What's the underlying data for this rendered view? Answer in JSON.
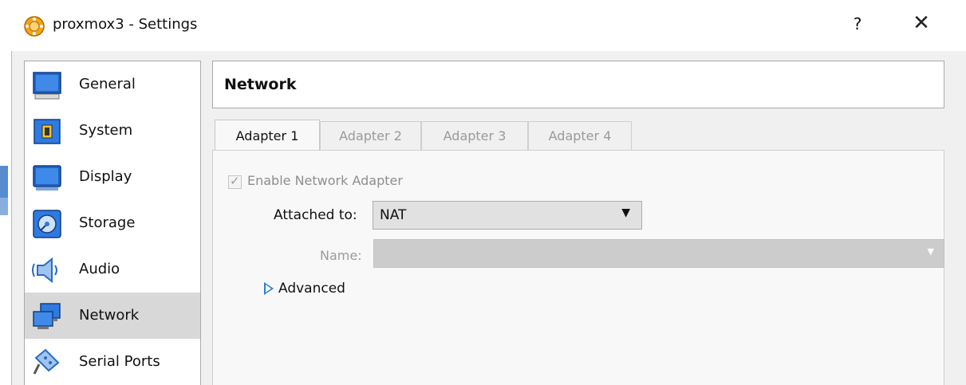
{
  "window": {
    "title": "proxmox3 - Settings",
    "help_label": "?",
    "close_label": "✕"
  },
  "sidebar": {
    "items": [
      {
        "label": "General",
        "icon": "general-icon",
        "selected": false
      },
      {
        "label": "System",
        "icon": "system-icon",
        "selected": false
      },
      {
        "label": "Display",
        "icon": "display-icon",
        "selected": false
      },
      {
        "label": "Storage",
        "icon": "storage-icon",
        "selected": false
      },
      {
        "label": "Audio",
        "icon": "audio-icon",
        "selected": false
      },
      {
        "label": "Network",
        "icon": "network-icon",
        "selected": true
      },
      {
        "label": "Serial Ports",
        "icon": "serial-ports-icon",
        "selected": false
      }
    ]
  },
  "main": {
    "section_title": "Network",
    "tabs": [
      {
        "label": "Adapter 1",
        "active": true
      },
      {
        "label": "Adapter 2",
        "active": false
      },
      {
        "label": "Adapter 3",
        "active": false
      },
      {
        "label": "Adapter 4",
        "active": false
      }
    ],
    "enable_adapter": {
      "label": "Enable Network Adapter",
      "checked": true,
      "enabled": false
    },
    "attached_to": {
      "label": "Attached to:",
      "value": "NAT"
    },
    "name": {
      "label": "Name:",
      "value": ""
    },
    "advanced_label": "Advanced"
  },
  "colors": {
    "accent": "#2a7fd4",
    "selected_bg": "#d8d8d8",
    "dialog_bg": "#f0f0f0"
  }
}
